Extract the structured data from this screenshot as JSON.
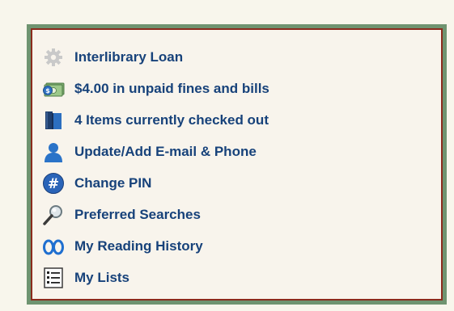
{
  "account_menu": {
    "items": [
      {
        "label": "Interlibrary Loan",
        "icon": "gear-icon"
      },
      {
        "label": "$4.00 in unpaid fines and bills",
        "icon": "money-icon"
      },
      {
        "label": "4 Items currently checked out",
        "icon": "books-icon"
      },
      {
        "label": "Update/Add E-mail & Phone",
        "icon": "person-icon"
      },
      {
        "label": "Change PIN",
        "icon": "hash-icon"
      },
      {
        "label": "Preferred Searches",
        "icon": "magnifier-icon"
      },
      {
        "label": "My Reading History",
        "icon": "glasses-icon"
      },
      {
        "label": "My Lists",
        "icon": "list-icon"
      }
    ]
  }
}
